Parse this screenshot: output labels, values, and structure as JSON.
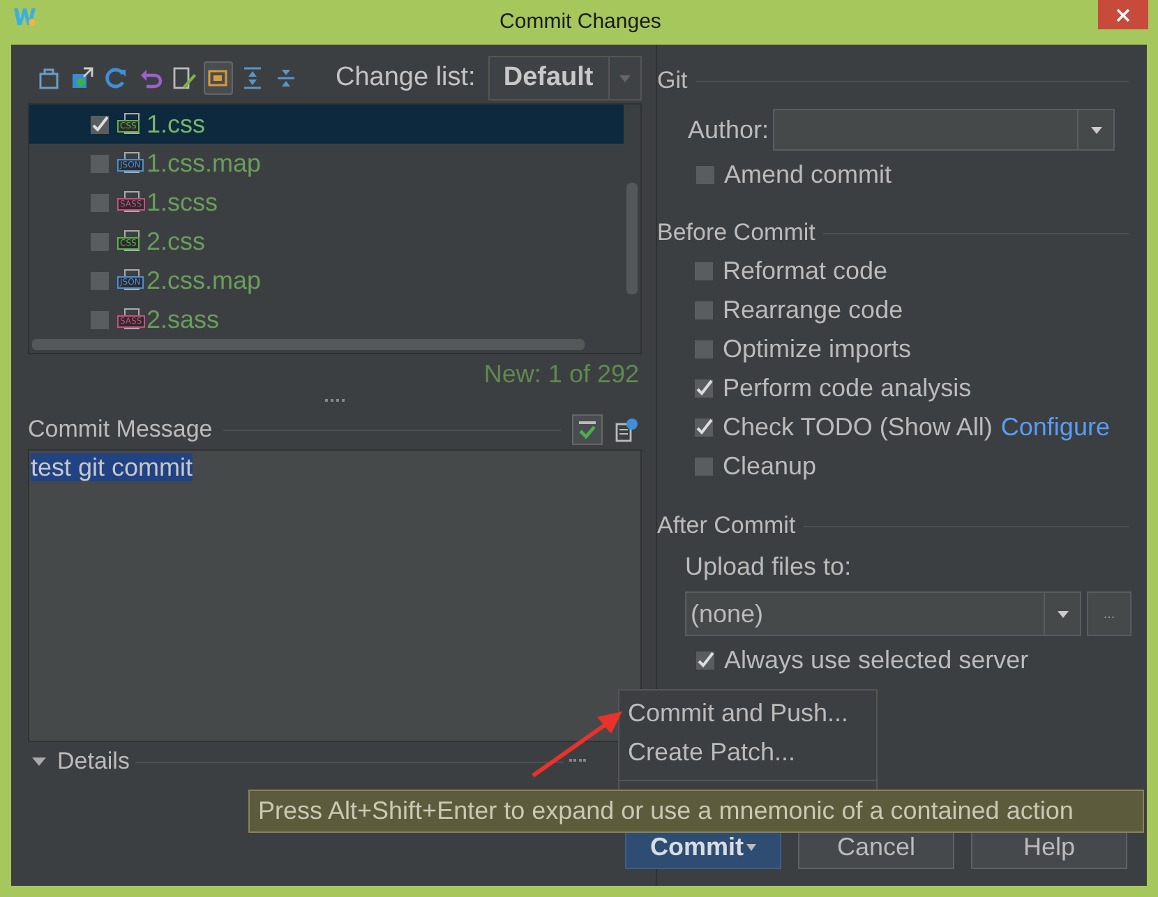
{
  "window": {
    "title": "Commit Changes"
  },
  "toolbar": [
    {
      "kind": "box",
      "selected": false
    },
    {
      "kind": "window",
      "selected": false
    },
    {
      "kind": "refresh",
      "selected": false
    },
    {
      "kind": "undo",
      "selected": false
    },
    {
      "kind": "edit",
      "selected": false
    },
    {
      "kind": "group",
      "selected": true
    },
    {
      "kind": "expand",
      "selected": false
    },
    {
      "kind": "collapse",
      "selected": false
    }
  ],
  "change_list": {
    "label": "Change list:",
    "value": "Default"
  },
  "files": [
    {
      "name": "1.css",
      "type": "CSS",
      "checked": true,
      "selected": true
    },
    {
      "name": "1.css.map",
      "type": "JSON",
      "checked": false,
      "selected": false
    },
    {
      "name": "1.scss",
      "type": "SASS",
      "checked": false,
      "selected": false
    },
    {
      "name": "2.css",
      "type": "CSS",
      "checked": false,
      "selected": false
    },
    {
      "name": "2.css.map",
      "type": "JSON",
      "checked": false,
      "selected": false
    },
    {
      "name": "2.sass",
      "type": "SASS",
      "checked": false,
      "selected": false
    }
  ],
  "file_count": "New: 1 of 292",
  "commit_message": {
    "label": "Commit Message",
    "value": "test git commit"
  },
  "details": {
    "label": "Details",
    "expanded": true
  },
  "git": {
    "title": "Git",
    "author_label": "Author:",
    "amend": {
      "label": "Amend commit",
      "checked": false
    }
  },
  "before_commit": {
    "title": "Before Commit",
    "options": [
      {
        "label": "Reformat code",
        "checked": false
      },
      {
        "label": "Rearrange code",
        "checked": false
      },
      {
        "label": "Optimize imports",
        "checked": false
      },
      {
        "label": "Perform code analysis",
        "checked": true
      },
      {
        "label": "Check TODO (Show All)",
        "checked": true,
        "link": "Configure"
      },
      {
        "label": "Cleanup",
        "checked": false
      }
    ]
  },
  "after_commit": {
    "title": "After Commit",
    "upload_label": "Upload files to:",
    "upload_value": "(none)",
    "more": "...",
    "always": {
      "label": "Always use selected server",
      "checked": true
    }
  },
  "popup_menu": [
    "Commit and Push...",
    "Create Patch..."
  ],
  "tooltip": "Press Alt+Shift+Enter to expand or use a mnemonic of a contained action",
  "buttons": [
    {
      "label": "Commit",
      "default": true,
      "dropdown": true
    },
    {
      "label": "Cancel",
      "default": false,
      "dropdown": false
    },
    {
      "label": "Help",
      "default": false,
      "dropdown": false
    }
  ]
}
